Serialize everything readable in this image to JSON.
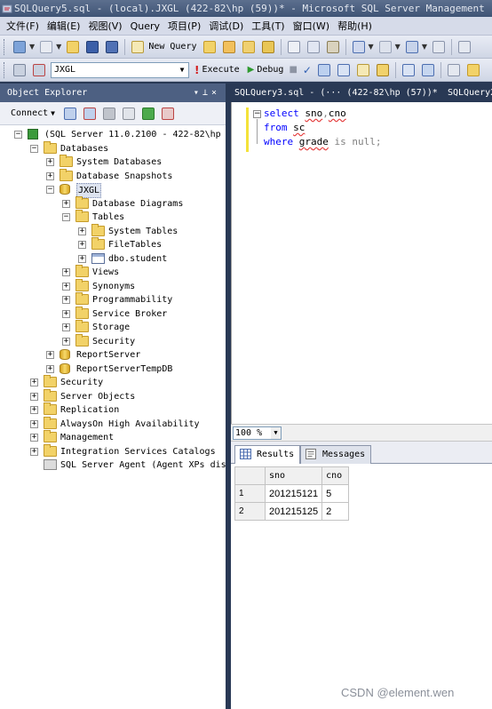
{
  "window": {
    "title": "SQLQuery5.sql - (local).JXGL (422-82\\hp (59))* - Microsoft SQL Server Management"
  },
  "menubar": {
    "items": [
      "文件(F)",
      "编辑(E)",
      "视图(V)",
      "Query",
      "项目(P)",
      "调试(D)",
      "工具(T)",
      "窗口(W)",
      "帮助(H)"
    ]
  },
  "toolbar1": {
    "new_query_label": "New Query"
  },
  "toolbar2": {
    "database_value": "JXGL",
    "execute_label": "Execute",
    "debug_label": "Debug"
  },
  "object_explorer": {
    "title": "Object Explorer",
    "connect_label": "Connect",
    "tree": [
      {
        "label": "(SQL Server 11.0.2100 - 422-82\\hp",
        "level": 0,
        "expanded": true,
        "icon": "server-icon"
      },
      {
        "label": "Databases",
        "level": 1,
        "expanded": true,
        "icon": "folder-icon"
      },
      {
        "label": "System Databases",
        "level": 2,
        "expanded": false,
        "icon": "folder-icon"
      },
      {
        "label": "Database Snapshots",
        "level": 2,
        "expanded": false,
        "icon": "folder-icon"
      },
      {
        "label": "JXGL",
        "level": 2,
        "expanded": true,
        "icon": "database-icon",
        "selected": true
      },
      {
        "label": "Database Diagrams",
        "level": 3,
        "expanded": false,
        "icon": "folder-icon"
      },
      {
        "label": "Tables",
        "level": 3,
        "expanded": true,
        "icon": "folder-icon"
      },
      {
        "label": "System Tables",
        "level": 4,
        "expanded": false,
        "icon": "folder-icon"
      },
      {
        "label": "FileTables",
        "level": 4,
        "expanded": false,
        "icon": "folder-icon"
      },
      {
        "label": "dbo.student",
        "level": 4,
        "expanded": false,
        "icon": "table-icon"
      },
      {
        "label": "Views",
        "level": 3,
        "expanded": false,
        "icon": "folder-icon"
      },
      {
        "label": "Synonyms",
        "level": 3,
        "expanded": false,
        "icon": "folder-icon"
      },
      {
        "label": "Programmability",
        "level": 3,
        "expanded": false,
        "icon": "folder-icon"
      },
      {
        "label": "Service Broker",
        "level": 3,
        "expanded": false,
        "icon": "folder-icon"
      },
      {
        "label": "Storage",
        "level": 3,
        "expanded": false,
        "icon": "folder-icon"
      },
      {
        "label": "Security",
        "level": 3,
        "expanded": false,
        "icon": "folder-icon"
      },
      {
        "label": "ReportServer",
        "level": 2,
        "expanded": false,
        "icon": "database-icon"
      },
      {
        "label": "ReportServerTempDB",
        "level": 2,
        "expanded": false,
        "icon": "database-icon"
      },
      {
        "label": "Security",
        "level": 1,
        "expanded": false,
        "icon": "folder-icon"
      },
      {
        "label": "Server Objects",
        "level": 1,
        "expanded": false,
        "icon": "folder-icon"
      },
      {
        "label": "Replication",
        "level": 1,
        "expanded": false,
        "icon": "folder-icon"
      },
      {
        "label": "AlwaysOn High Availability",
        "level": 1,
        "expanded": false,
        "icon": "folder-icon"
      },
      {
        "label": "Management",
        "level": 1,
        "expanded": false,
        "icon": "folder-icon"
      },
      {
        "label": "Integration Services Catalogs",
        "level": 1,
        "expanded": false,
        "icon": "folder-icon"
      },
      {
        "label": "SQL Server Agent (Agent XPs dis",
        "level": 1,
        "expanded": null,
        "icon": "agent-icon"
      }
    ]
  },
  "document_tabs": [
    {
      "label": "SQLQuery3.sql - (··· (422-82\\hp (57))*"
    },
    {
      "label": "SQLQuery2"
    }
  ],
  "editor": {
    "lines": [
      [
        {
          "t": "select",
          "c": "kw"
        },
        {
          "t": " ",
          "c": ""
        },
        {
          "t": "sno",
          "c": "id"
        },
        {
          "t": ",",
          "c": "op"
        },
        {
          "t": "cno",
          "c": "id"
        }
      ],
      [
        {
          "t": "from",
          "c": "kw"
        },
        {
          "t": " ",
          "c": ""
        },
        {
          "t": "sc",
          "c": "id"
        }
      ],
      [
        {
          "t": "where",
          "c": "kw"
        },
        {
          "t": " ",
          "c": ""
        },
        {
          "t": "grade",
          "c": "id"
        },
        {
          "t": " ",
          "c": ""
        },
        {
          "t": "is null",
          "c": "nl"
        },
        {
          "t": ";",
          "c": "op"
        }
      ]
    ]
  },
  "zoom": {
    "value": "100 %"
  },
  "results": {
    "tabs": [
      "Results",
      "Messages"
    ],
    "columns": [
      "sno",
      "cno"
    ],
    "rows": [
      {
        "num": "1",
        "sno": "201215121",
        "cno": "5"
      },
      {
        "num": "2",
        "sno": "201215125",
        "cno": "2"
      }
    ]
  },
  "watermark": "CSDN @element.wen",
  "colors": {
    "frame": "#293955",
    "keyword": "#0000ff",
    "folder": "#f2d268"
  }
}
